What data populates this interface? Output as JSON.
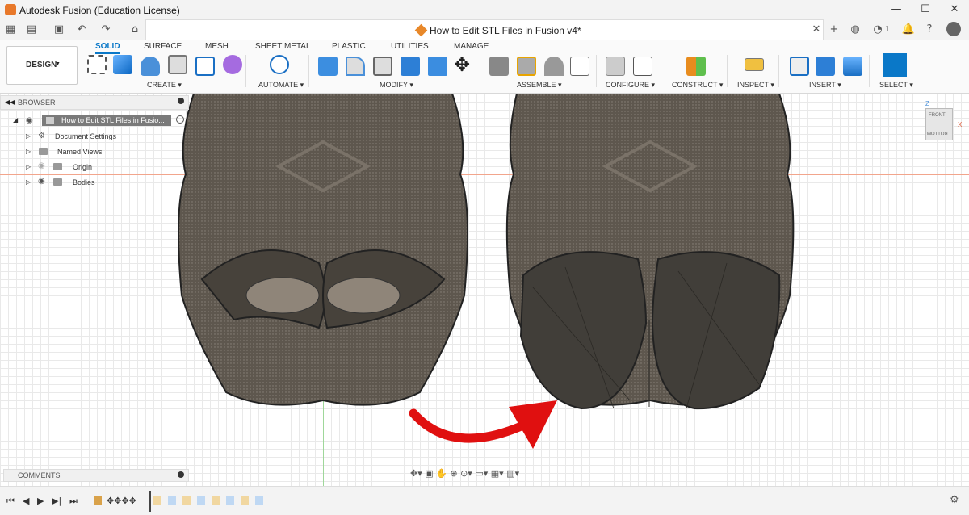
{
  "window": {
    "title": "Autodesk Fusion (Education License)",
    "minimize": "—",
    "maximize": "☐",
    "close": "✕"
  },
  "document_tab": {
    "title": "How to Edit STL Files in Fusion v4*",
    "close": "✕",
    "add": "+"
  },
  "header_right": {
    "jobs_count": "1"
  },
  "ribbon": {
    "tabs": [
      "SOLID",
      "SURFACE",
      "MESH",
      "SHEET METAL",
      "PLASTIC",
      "UTILITIES",
      "MANAGE"
    ],
    "workspace_label": "DESIGN",
    "groups": [
      "CREATE",
      "AUTOMATE",
      "MODIFY",
      "ASSEMBLE",
      "CONFIGURE",
      "CONSTRUCT",
      "INSPECT",
      "INSERT",
      "SELECT"
    ]
  },
  "browser": {
    "title": "BROWSER",
    "root": "How to Edit STL Files in Fusio...",
    "items": [
      "Document Settings",
      "Named Views",
      "Origin",
      "Bodies"
    ]
  },
  "viewcube": {
    "front": "FRONT",
    "bottom": "BOTTOM",
    "z": "Z",
    "x": "X"
  },
  "comments": {
    "label": "COMMENTS"
  },
  "colors": {
    "accent": "#0a78c8",
    "mesh": "#5e574e",
    "arrow": "#e01010"
  }
}
